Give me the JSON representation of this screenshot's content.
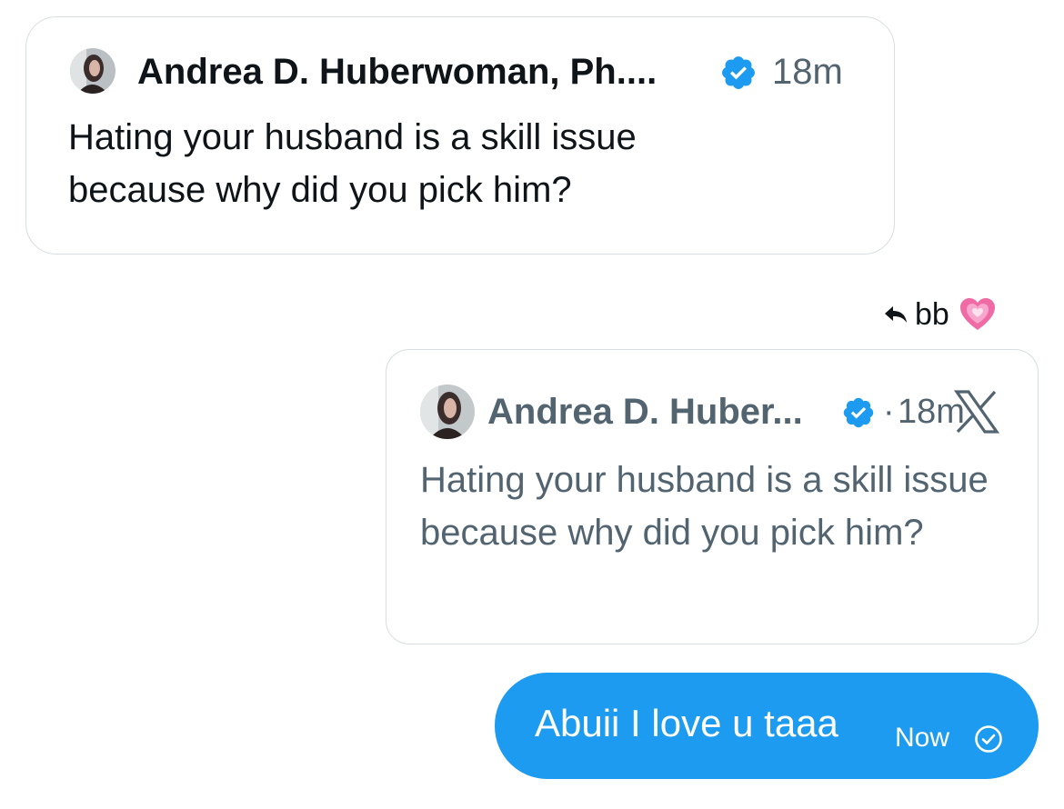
{
  "quoted_tweet": {
    "author": "Andrea D. Huberwoman, Ph....",
    "time": "18m",
    "text": "Hating your husband is a skill issue because why did you pick him?"
  },
  "reply_context": {
    "to": "bb",
    "icon": "reply-arrow-icon",
    "emoji": "growing-heart-icon"
  },
  "embedded_quote": {
    "author": "Andrea D. Huber...",
    "separator": "·",
    "time": "18m",
    "source_icon": "x-logo-icon",
    "text": "Hating your husband is a skill issue because why did you pick him?"
  },
  "message": {
    "text": "Abuii I love u taaa",
    "status": "Now",
    "status_icon": "sent-check-icon"
  },
  "colors": {
    "bubble": "#1d9bf0",
    "verified": "#1d9bf0",
    "muted_text": "#536471",
    "border": "#d8dde1"
  }
}
